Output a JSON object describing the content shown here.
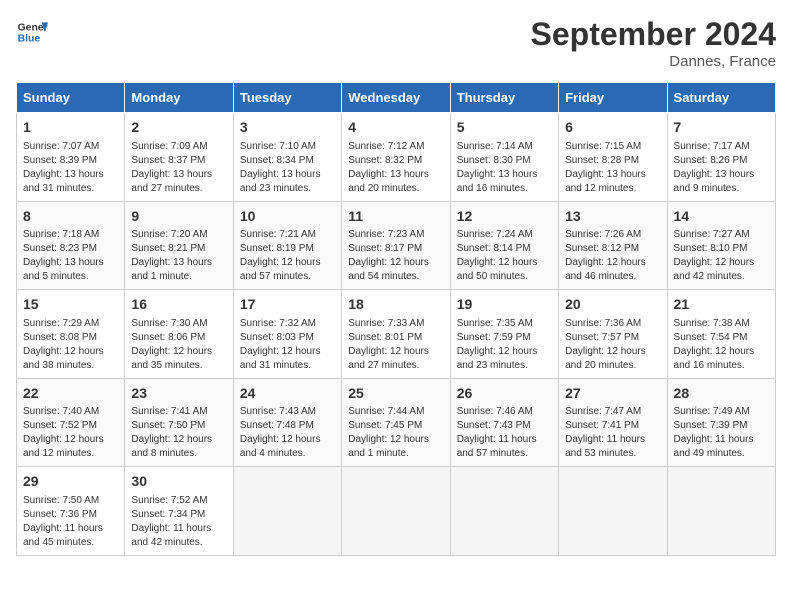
{
  "header": {
    "logo_line1": "General",
    "logo_line2": "Blue",
    "month_year": "September 2024",
    "location": "Dannes, France"
  },
  "days_of_week": [
    "Sunday",
    "Monday",
    "Tuesday",
    "Wednesday",
    "Thursday",
    "Friday",
    "Saturday"
  ],
  "weeks": [
    [
      {
        "day": "1",
        "info": "Sunrise: 7:07 AM\nSunset: 8:39 PM\nDaylight: 13 hours\nand 31 minutes."
      },
      {
        "day": "2",
        "info": "Sunrise: 7:09 AM\nSunset: 8:37 PM\nDaylight: 13 hours\nand 27 minutes."
      },
      {
        "day": "3",
        "info": "Sunrise: 7:10 AM\nSunset: 8:34 PM\nDaylight: 13 hours\nand 23 minutes."
      },
      {
        "day": "4",
        "info": "Sunrise: 7:12 AM\nSunset: 8:32 PM\nDaylight: 13 hours\nand 20 minutes."
      },
      {
        "day": "5",
        "info": "Sunrise: 7:14 AM\nSunset: 8:30 PM\nDaylight: 13 hours\nand 16 minutes."
      },
      {
        "day": "6",
        "info": "Sunrise: 7:15 AM\nSunset: 8:28 PM\nDaylight: 13 hours\nand 12 minutes."
      },
      {
        "day": "7",
        "info": "Sunrise: 7:17 AM\nSunset: 8:26 PM\nDaylight: 13 hours\nand 9 minutes."
      }
    ],
    [
      {
        "day": "8",
        "info": "Sunrise: 7:18 AM\nSunset: 8:23 PM\nDaylight: 13 hours\nand 5 minutes."
      },
      {
        "day": "9",
        "info": "Sunrise: 7:20 AM\nSunset: 8:21 PM\nDaylight: 13 hours\nand 1 minute."
      },
      {
        "day": "10",
        "info": "Sunrise: 7:21 AM\nSunset: 8:19 PM\nDaylight: 12 hours\nand 57 minutes."
      },
      {
        "day": "11",
        "info": "Sunrise: 7:23 AM\nSunset: 8:17 PM\nDaylight: 12 hours\nand 54 minutes."
      },
      {
        "day": "12",
        "info": "Sunrise: 7:24 AM\nSunset: 8:14 PM\nDaylight: 12 hours\nand 50 minutes."
      },
      {
        "day": "13",
        "info": "Sunrise: 7:26 AM\nSunset: 8:12 PM\nDaylight: 12 hours\nand 46 minutes."
      },
      {
        "day": "14",
        "info": "Sunrise: 7:27 AM\nSunset: 8:10 PM\nDaylight: 12 hours\nand 42 minutes."
      }
    ],
    [
      {
        "day": "15",
        "info": "Sunrise: 7:29 AM\nSunset: 8:08 PM\nDaylight: 12 hours\nand 38 minutes."
      },
      {
        "day": "16",
        "info": "Sunrise: 7:30 AM\nSunset: 8:06 PM\nDaylight: 12 hours\nand 35 minutes."
      },
      {
        "day": "17",
        "info": "Sunrise: 7:32 AM\nSunset: 8:03 PM\nDaylight: 12 hours\nand 31 minutes."
      },
      {
        "day": "18",
        "info": "Sunrise: 7:33 AM\nSunset: 8:01 PM\nDaylight: 12 hours\nand 27 minutes."
      },
      {
        "day": "19",
        "info": "Sunrise: 7:35 AM\nSunset: 7:59 PM\nDaylight: 12 hours\nand 23 minutes."
      },
      {
        "day": "20",
        "info": "Sunrise: 7:36 AM\nSunset: 7:57 PM\nDaylight: 12 hours\nand 20 minutes."
      },
      {
        "day": "21",
        "info": "Sunrise: 7:38 AM\nSunset: 7:54 PM\nDaylight: 12 hours\nand 16 minutes."
      }
    ],
    [
      {
        "day": "22",
        "info": "Sunrise: 7:40 AM\nSunset: 7:52 PM\nDaylight: 12 hours\nand 12 minutes."
      },
      {
        "day": "23",
        "info": "Sunrise: 7:41 AM\nSunset: 7:50 PM\nDaylight: 12 hours\nand 8 minutes."
      },
      {
        "day": "24",
        "info": "Sunrise: 7:43 AM\nSunset: 7:48 PM\nDaylight: 12 hours\nand 4 minutes."
      },
      {
        "day": "25",
        "info": "Sunrise: 7:44 AM\nSunset: 7:45 PM\nDaylight: 12 hours\nand 1 minute."
      },
      {
        "day": "26",
        "info": "Sunrise: 7:46 AM\nSunset: 7:43 PM\nDaylight: 11 hours\nand 57 minutes."
      },
      {
        "day": "27",
        "info": "Sunrise: 7:47 AM\nSunset: 7:41 PM\nDaylight: 11 hours\nand 53 minutes."
      },
      {
        "day": "28",
        "info": "Sunrise: 7:49 AM\nSunset: 7:39 PM\nDaylight: 11 hours\nand 49 minutes."
      }
    ],
    [
      {
        "day": "29",
        "info": "Sunrise: 7:50 AM\nSunset: 7:36 PM\nDaylight: 11 hours\nand 45 minutes."
      },
      {
        "day": "30",
        "info": "Sunrise: 7:52 AM\nSunset: 7:34 PM\nDaylight: 11 hours\nand 42 minutes."
      },
      {
        "day": "",
        "info": ""
      },
      {
        "day": "",
        "info": ""
      },
      {
        "day": "",
        "info": ""
      },
      {
        "day": "",
        "info": ""
      },
      {
        "day": "",
        "info": ""
      }
    ]
  ]
}
